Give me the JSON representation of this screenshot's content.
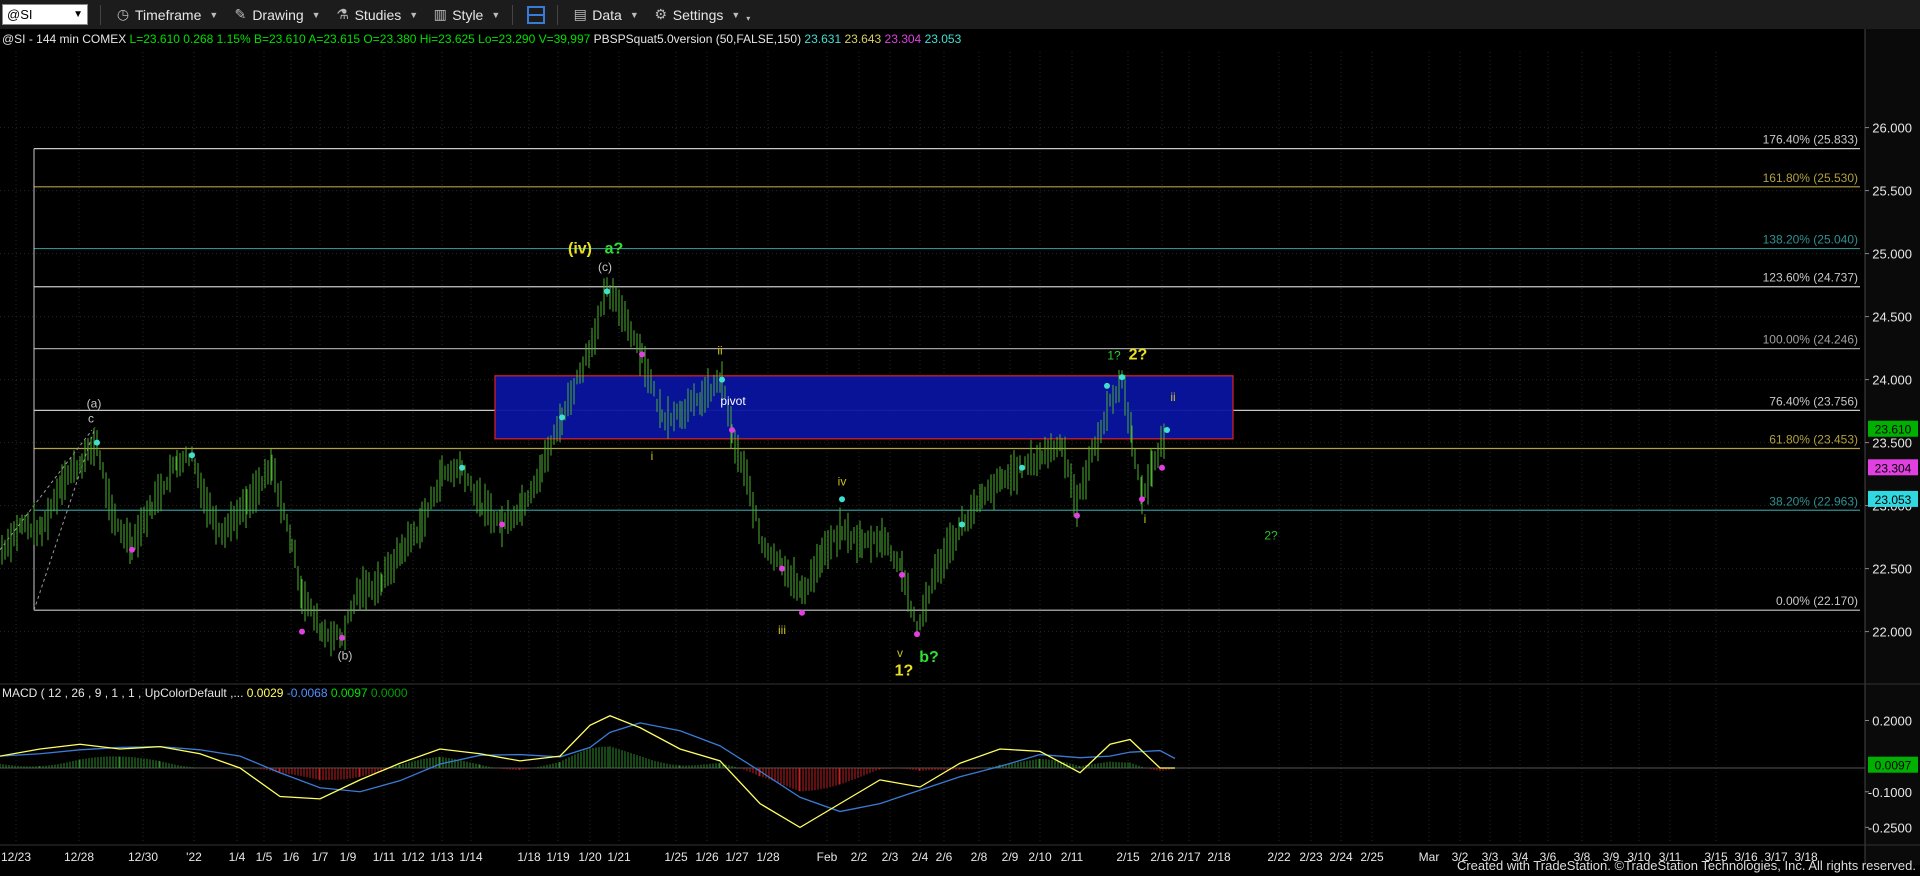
{
  "toolbar": {
    "symbol": "@SI",
    "items": [
      {
        "label": "Timeframe",
        "icon": "clock-icon"
      },
      {
        "label": "Drawing",
        "icon": "pencil-icon"
      },
      {
        "label": "Studies",
        "icon": "flask-icon"
      },
      {
        "label": "Style",
        "icon": "palette-icon"
      },
      {
        "label": "",
        "icon": "layout-icon"
      },
      {
        "label": "Data",
        "icon": "data-icon"
      },
      {
        "label": "Settings",
        "icon": "gear-icon"
      }
    ]
  },
  "info_line": [
    {
      "text": "@SI - 144 min  COMEX  ",
      "color": "#e6e6e6"
    },
    {
      "text": "L=23.610  0.268  1.15%  B=23.610  A=23.615  O=23.380  Hi=23.625  Lo=23.290  V=39,997  ",
      "color": "#00e000"
    },
    {
      "text": "PBSPSquat5.0version (50,FALSE,150)  ",
      "color": "#e6e6e6"
    },
    {
      "text": "23.631  ",
      "color": "#40e0d0"
    },
    {
      "text": "23.643  ",
      "color": "#d8d060"
    },
    {
      "text": "23.304  ",
      "color": "#e040e0"
    },
    {
      "text": "23.053",
      "color": "#40e0d0"
    }
  ],
  "macd_label": [
    {
      "text": "MACD ( 12 , 26 , 9 , 1 , 1 , UpColorDefault ,...  ",
      "color": "#e6e6e6"
    },
    {
      "text": "0.0029  ",
      "color": "#ffff60"
    },
    {
      "text": "-0.0068  ",
      "color": "#5090ff"
    },
    {
      "text": "0.0097  ",
      "color": "#00e000"
    },
    {
      "text": "0.0000",
      "color": "#00a000"
    }
  ],
  "chart_data": {
    "type": "candlestick-bars",
    "symbol": "@SI",
    "interval": "144 min",
    "y_axis": {
      "ticks": [
        "26.000",
        "25.500",
        "25.000",
        "24.500",
        "24.000",
        "23.500",
        "23.000",
        "22.500",
        "22.000"
      ],
      "tick_values": [
        26.0,
        25.5,
        25.0,
        24.5,
        24.0,
        23.5,
        23.0,
        22.5,
        22.0
      ],
      "range": [
        21.6,
        26.6
      ]
    },
    "price_badges": [
      {
        "text": "23.610",
        "value": 23.61,
        "color": "#00b000"
      },
      {
        "text": "23.304",
        "value": 23.304,
        "color": "#e040e0"
      },
      {
        "text": "23.053",
        "value": 23.053,
        "color": "#30d8e0"
      }
    ],
    "x_axis": {
      "labels": [
        "12/23",
        "12/28",
        "12/30",
        "'22",
        "1/4",
        "1/5",
        "1/6",
        "1/7",
        "1/9",
        "1/11",
        "1/12",
        "1/13",
        "1/14",
        "1/18",
        "1/19",
        "1/20",
        "1/21",
        "1/25",
        "1/26",
        "1/27",
        "1/28",
        "Feb",
        "2/2",
        "2/3",
        "2/4",
        "2/6",
        "2/8",
        "2/9",
        "2/10",
        "2/11",
        "2/15",
        "2/16",
        "2/17",
        "2/18",
        "2/22",
        "2/23",
        "2/24",
        "2/25",
        "Mar",
        "3/2",
        "3/3",
        "3/4",
        "3/6",
        "3/8",
        "3/9",
        "3/10",
        "3/11",
        "3/15",
        "3/16",
        "3/17",
        "3/18"
      ]
    },
    "fib_levels": [
      {
        "label": "176.40% (25.833)",
        "value": 25.833,
        "color": "#c8c8c8"
      },
      {
        "label": "161.80% (25.530)",
        "value": 25.53,
        "color": "#b0a040"
      },
      {
        "label": "138.20% (25.040)",
        "value": 25.04,
        "color": "#309090"
      },
      {
        "label": "123.60% (24.737)",
        "value": 24.737,
        "color": "#c8c8c8"
      },
      {
        "label": "100.00% (24.246)",
        "value": 24.246,
        "color": "#a0a0a0"
      },
      {
        "label": "76.40% (23.756)",
        "value": 23.756,
        "color": "#c8c8c8"
      },
      {
        "label": "61.80% (23.453)",
        "value": 23.453,
        "color": "#b0a040"
      },
      {
        "label": "38.20% (22.963)",
        "value": 22.963,
        "color": "#309090"
      },
      {
        "label": "0.00% (22.170)",
        "value": 22.17,
        "color": "#c8c8c8"
      }
    ],
    "pivot_zone": {
      "label": "pivot",
      "top": 24.03,
      "bottom": 23.53
    },
    "wave_labels": [
      {
        "text": "(a)",
        "x_label": "12/28",
        "value": 23.78,
        "color": "#c8c8c8"
      },
      {
        "text": "c",
        "x_label": "12/28",
        "value": 23.66,
        "color": "#c8c8c8"
      },
      {
        "text": "(b)",
        "x_label": "1/7",
        "value": 21.78,
        "color": "#c8c8c8"
      },
      {
        "text": "(iv)",
        "x_label": "1/20",
        "value": 25.0,
        "color": "#e8e020"
      },
      {
        "text": "a?",
        "x_label": "1/21",
        "value": 25.0,
        "color": "#30e030"
      },
      {
        "text": "(c)",
        "x_label": "1/20",
        "value": 24.86,
        "color": "#c8c8c8"
      },
      {
        "text": "ii",
        "x_label": "1/26",
        "value": 24.2,
        "color": "#c8c020"
      },
      {
        "text": "i",
        "x_label": "1/25",
        "value": 23.36,
        "color": "#c8c020"
      },
      {
        "text": "pivot-label",
        "x_label": "1/26",
        "value": 23.8,
        "color": "#ffffff"
      },
      {
        "text": "iii",
        "x_label": "1/28",
        "value": 21.98,
        "color": "#c8c020"
      },
      {
        "text": "iv",
        "x_label": "2/2",
        "value": 23.16,
        "color": "#c8c020"
      },
      {
        "text": "v",
        "x_label": "2/3",
        "value": 21.8,
        "color": "#c8c020"
      },
      {
        "text": "1?",
        "x_label": "2/3",
        "value": 21.65,
        "color": "#e8e020"
      },
      {
        "text": "b?",
        "x_label": "2/4",
        "value": 21.76,
        "color": "#30e030"
      },
      {
        "text": "1?",
        "x_label": "2/15",
        "value": 24.16,
        "color": "#30d030"
      },
      {
        "text": "2?",
        "x_label": "2/15",
        "value": 24.16,
        "color": "#e8e020"
      },
      {
        "text": "ii",
        "x_label": "2/16",
        "value": 23.83,
        "color": "#c8c020"
      },
      {
        "text": "i",
        "x_label": "2/16",
        "value": 22.86,
        "color": "#c8c020"
      },
      {
        "text": "2?",
        "x_label": "2/22",
        "value": 22.73,
        "color": "#30c030"
      }
    ],
    "macd": {
      "y_ticks": [
        "0.2000",
        "-0.1000",
        "-0.2500"
      ],
      "y_values": [
        0.2,
        -0.1,
        -0.25
      ],
      "range": [
        -0.32,
        0.32
      ],
      "current_badge": {
        "text": "0.0097",
        "color": "#00b000"
      }
    }
  },
  "footer": "Created with TradeStation. ©TradeStation Technologies, Inc. All rights reserved."
}
